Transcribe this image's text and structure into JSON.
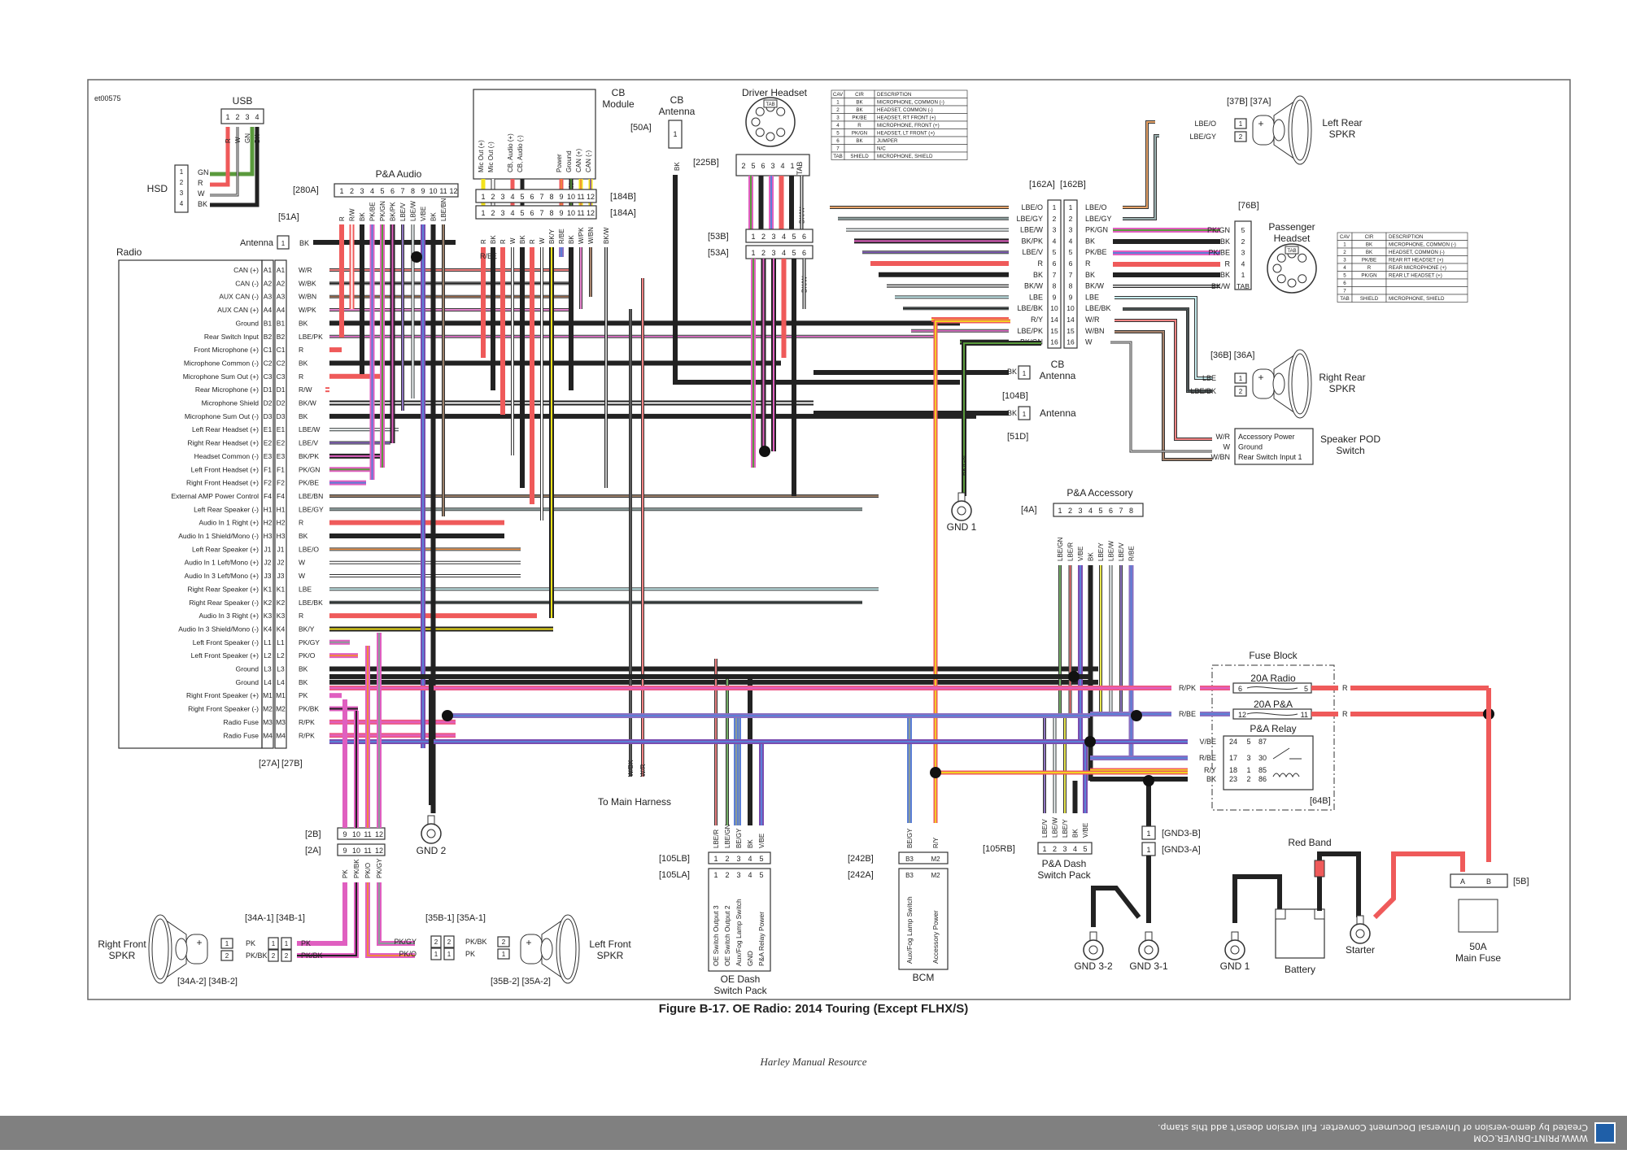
{
  "document": {
    "figure_id": "et00575",
    "caption": "Figure B-17. OE Radio: 2014 Touring (Except FLHX/S)",
    "footer": "Harley Manual Resource",
    "stamp": {
      "line1": "WWW.PRINT-DRIVER.COM",
      "line2": "Created by demo-version of Universal Document Converter. Full version doesn't add this stamp."
    }
  },
  "wire_colors": {
    "R": "#ef5a5a",
    "BK": "#222222",
    "W": "#ffffff",
    "GN": "#5a9a3c",
    "Y": "#f3e31b",
    "O": "#f08a3c",
    "PK": "#e05fc0",
    "V": "#7a4db0",
    "BE": "#5b7fd6",
    "LBE": "#c8eef0",
    "BN": "#8a5a3c",
    "GY": "#8a9a98",
    "R/PK": "#ec5a88",
    "R/BE": "#8a6fc0"
  },
  "components": {
    "usb": {
      "label": "USB",
      "pins": [
        "1",
        "2",
        "3",
        "4"
      ],
      "wires": [
        "R",
        "W",
        "GN",
        "BK"
      ]
    },
    "hsd": {
      "label": "HSD",
      "pins": [
        {
          "pin": "1",
          "wire": "GN"
        },
        {
          "pin": "2",
          "wire": "R"
        },
        {
          "pin": "3",
          "wire": "W"
        },
        {
          "pin": "4",
          "wire": "BK"
        }
      ]
    },
    "antenna_51a": {
      "label": "Antenna",
      "connector": "[51A]",
      "pin": "1",
      "wire": "BK"
    },
    "radio": {
      "label": "Radio",
      "connector_left": "[27A]",
      "connector_right": "[27B]",
      "pins": [
        {
          "pin": "A1",
          "desc": "CAN (+)",
          "wire": "W/R"
        },
        {
          "pin": "A2",
          "desc": "CAN (-)",
          "wire": "W/BK"
        },
        {
          "pin": "A3",
          "desc": "AUX CAN (-)",
          "wire": "W/BN"
        },
        {
          "pin": "A4",
          "desc": "AUX CAN (+)",
          "wire": "W/PK"
        },
        {
          "pin": "B1",
          "desc": "Ground",
          "wire": "BK"
        },
        {
          "pin": "B2",
          "desc": "Rear Switch Input",
          "wire": "LBE/PK"
        },
        {
          "pin": "C1",
          "desc": "Front Microphone (+)",
          "wire": "R"
        },
        {
          "pin": "C2",
          "desc": "Microphone Common (-)",
          "wire": "BK"
        },
        {
          "pin": "C3",
          "desc": "Microphone Sum Out (+)",
          "wire": "R"
        },
        {
          "pin": "D1",
          "desc": "Rear Microphone (+)",
          "wire": "R/W"
        },
        {
          "pin": "D2",
          "desc": "Microphone Shield",
          "wire": "BK/W"
        },
        {
          "pin": "D3",
          "desc": "Microphone Sum Out (-)",
          "wire": "BK"
        },
        {
          "pin": "E1",
          "desc": "Left Rear Headset (+)",
          "wire": "LBE/W"
        },
        {
          "pin": "E2",
          "desc": "Right Rear Headset (+)",
          "wire": "LBE/V"
        },
        {
          "pin": "E3",
          "desc": "Headset Common (-)",
          "wire": "BK/PK"
        },
        {
          "pin": "F1",
          "desc": "Left Front Headset (+)",
          "wire": "PK/GN"
        },
        {
          "pin": "F2",
          "desc": "Right Front Headset (+)",
          "wire": "PK/BE"
        },
        {
          "pin": "F4",
          "desc": "External AMP Power Control",
          "wire": "LBE/BN"
        },
        {
          "pin": "H1",
          "desc": "Left Rear Speaker (-)",
          "wire": "LBE/GY"
        },
        {
          "pin": "H2",
          "desc": "Audio In 1 Right (+)",
          "wire": "R"
        },
        {
          "pin": "H3",
          "desc": "Audio In 1 Shield/Mono (-)",
          "wire": "BK"
        },
        {
          "pin": "J1",
          "desc": "Left Rear Speaker (+)",
          "wire": "LBE/O"
        },
        {
          "pin": "J2",
          "desc": "Audio In 1 Left/Mono (+)",
          "wire": "W"
        },
        {
          "pin": "J3",
          "desc": "Audio In 3 Left/Mono (+)",
          "wire": "W"
        },
        {
          "pin": "K1",
          "desc": "Right Rear Speaker (+)",
          "wire": "LBE"
        },
        {
          "pin": "K2",
          "desc": "Right Rear Speaker (-)",
          "wire": "LBE/BK"
        },
        {
          "pin": "K3",
          "desc": "Audio In 3 Right (+)",
          "wire": "R"
        },
        {
          "pin": "K4",
          "desc": "Audio In 3 Shield/Mono (-)",
          "wire": "BK/Y"
        },
        {
          "pin": "L1",
          "desc": "Left Front Speaker (-)",
          "wire": "PK/GY"
        },
        {
          "pin": "L2",
          "desc": "Left Front Speaker (+)",
          "wire": "PK/O"
        },
        {
          "pin": "L3",
          "desc": "Ground",
          "wire": "BK"
        },
        {
          "pin": "L4",
          "desc": "Ground",
          "wire": "BK"
        },
        {
          "pin": "M1",
          "desc": "Right Front Speaker (+)",
          "wire": "PK"
        },
        {
          "pin": "M2",
          "desc": "Right Front Speaker (-)",
          "wire": "PK/BK"
        },
        {
          "pin": "M3",
          "desc": "Radio Fuse",
          "wire": "R/PK"
        },
        {
          "pin": "M4",
          "desc": "Radio Fuse",
          "wire": "R/PK"
        }
      ]
    },
    "pa_audio": {
      "label": "P&A Audio",
      "connector": "[280A]",
      "pins": [
        "1",
        "2",
        "3",
        "4",
        "5",
        "6",
        "7",
        "8",
        "9",
        "10",
        "11",
        "12"
      ],
      "wires": [
        "R",
        "R/W",
        "BK",
        "PK/BE",
        "PK/GN",
        "BK/PK",
        "LBE/V",
        "LBE/W",
        "V/BE",
        "BK",
        "LBE/BN",
        ""
      ]
    },
    "cb_module": {
      "label": "CB Module",
      "functions": [
        "Mic Out (+)",
        "Mic Out (-)",
        "",
        "CB, Audio (+)",
        "CB, Audio (-)",
        "",
        "",
        "",
        "Power",
        "Ground",
        "CAN (+)",
        "CAN (-)"
      ],
      "top_wires": [
        "Y",
        "W",
        "",
        "R",
        "BK",
        "",
        "",
        "",
        "R/O",
        "BK/GN",
        "Y/O",
        "Y/V"
      ],
      "connector_b": "[184B]",
      "connector_a": "[184A]",
      "pins": [
        "1",
        "2",
        "3",
        "4",
        "5",
        "6",
        "7",
        "8",
        "9",
        "10",
        "11",
        "12"
      ],
      "bottom_wires": [
        "R",
        "BK",
        "R",
        "W",
        "BK",
        "R",
        "W",
        "BK/Y",
        "R/BE",
        "BK",
        "W/PK",
        "W/BN"
      ],
      "extra_wire": "BK/W"
    },
    "cb_antenna_50a": {
      "label": "CB Antenna",
      "connector": "[50A]",
      "pin": "1",
      "wire": "BK"
    },
    "driver_headset": {
      "label": "Driver Headset",
      "connector": "[225B]",
      "pins": [
        "2",
        "5",
        "6",
        "3",
        "4",
        "1",
        "TAB"
      ],
      "wires": [
        "PK/GN",
        "BK",
        "PK/BE",
        "R",
        "BK",
        "BK/W"
      ],
      "connector_53b": "[53B]",
      "connector_53a": "[53A]",
      "pins_53": [
        "1",
        "2",
        "3",
        "4",
        "5",
        "6"
      ],
      "wires_53a": [
        "PK/GN",
        "BK/PK",
        "BK/PK",
        "R",
        "BK",
        "BK/W"
      ],
      "table": {
        "headers": [
          "CAV",
          "CIR",
          "DESCRIPTION"
        ],
        "rows": [
          [
            "1",
            "BK",
            "MICROPHONE, COMMON (-)"
          ],
          [
            "2",
            "BK",
            "HEADSET, COMMON (-)"
          ],
          [
            "3",
            "PK/BE",
            "HEADSET, RT FRONT (+)"
          ],
          [
            "4",
            "R",
            "MICROPHONE, FRONT (+)"
          ],
          [
            "5",
            "PK/GN",
            "HEADSET, LT FRONT (+)"
          ],
          [
            "6",
            "BK",
            "JUMPER"
          ],
          [
            "7",
            "",
            "N/C"
          ],
          [
            "TAB",
            "SHIELD",
            "MICROPHONE, SHIELD"
          ]
        ]
      }
    },
    "connector_162": {
      "label_a": "[162A]",
      "label_b": "[162B]",
      "pins": [
        "1",
        "2",
        "3",
        "4",
        "5",
        "6",
        "7",
        "8",
        "9",
        "10",
        "14",
        "15",
        "16"
      ],
      "left_wires": [
        "LBE/O",
        "LBE/GY",
        "LBE/W",
        "BK/PK",
        "LBE/V",
        "R",
        "BK",
        "BK/W",
        "LBE",
        "LBE/BK",
        "R/Y",
        "LBE/PK",
        "BK/GN"
      ],
      "right_wires": [
        "LBE/O",
        "LBE/GY",
        "PK/GN",
        "BK",
        "PK/BE",
        "R",
        "BK",
        "BK/W",
        "LBE",
        "LBE/BK",
        "W/R",
        "W/BN",
        "W"
      ]
    },
    "left_rear_spkr": {
      "label": "Left Rear SPKR",
      "connectors": "[37B] [37A]",
      "pins": [
        {
          "pin": "1",
          "wire": "LBE/O"
        },
        {
          "pin": "2",
          "wire": "LBE/GY"
        }
      ]
    },
    "passenger_headset": {
      "label": "Passenger Headset",
      "connector": "[76B]",
      "pins": [
        {
          "pin": "5",
          "wire": "PK/GN"
        },
        {
          "pin": "2",
          "wire": "BK"
        },
        {
          "pin": "3",
          "wire": "PK/BE"
        },
        {
          "pin": "4",
          "wire": "R"
        },
        {
          "pin": "1",
          "wire": "BK"
        },
        {
          "pin": "TAB",
          "wire": "BK/W"
        }
      ],
      "table": {
        "headers": [
          "CAV",
          "CIR",
          "DESCRIPTION"
        ],
        "rows": [
          [
            "1",
            "BK",
            "MICROPHONE, COMMON (-)"
          ],
          [
            "2",
            "BK",
            "HEADSET, COMMON (-)"
          ],
          [
            "3",
            "PK/BE",
            "REAR RT HEADSET (+)"
          ],
          [
            "4",
            "R",
            "REAR MICROPHONE (+)"
          ],
          [
            "5",
            "PK/GN",
            "REAR LT HEADSET (+)"
          ],
          [
            "6",
            "",
            ""
          ],
          [
            "7",
            "",
            ""
          ],
          [
            "TAB",
            "SHIELD",
            "MICROPHONE, SHIELD"
          ]
        ]
      }
    },
    "cb_antenna_104b": {
      "label": "CB Antenna",
      "connector": "[104B]",
      "pin": "1",
      "wire": "BK"
    },
    "antenna_51d": {
      "label": "Antenna",
      "connector": "[51D]",
      "pin": "1",
      "wire": "BK"
    },
    "right_rear_spkr": {
      "label": "Right Rear SPKR",
      "connectors": "[36B] [36A]",
      "pins": [
        {
          "pin": "1",
          "wire": "LBE"
        },
        {
          "pin": "2",
          "wire": "LBE/BK"
        }
      ]
    },
    "speaker_pod_switch": {
      "label": "Speaker POD Switch",
      "pins": [
        {
          "function": "Accessory Power",
          "wire": "W/R"
        },
        {
          "function": "Ground",
          "wire": "W"
        },
        {
          "function": "Rear Switch Input 1",
          "wire": "W/BN"
        }
      ]
    },
    "gnd1_upper": {
      "label": "GND 1",
      "wire": "BK/GN"
    },
    "pa_accessory": {
      "label": "P&A Accessory",
      "connector": "[4A]",
      "pins": [
        "1",
        "2",
        "3",
        "4",
        "5",
        "6",
        "7",
        "8"
      ],
      "wires": [
        "LBE/GN",
        "LBE/R",
        "V/BE",
        "BK",
        "LBE/Y",
        "LBE/W",
        "LBE/V",
        "R/BE"
      ]
    },
    "fuse_block": {
      "label": "Fuse Block",
      "connector": "[64B]",
      "fuses": [
        {
          "name": "20A Radio",
          "in_pin": "6",
          "out_pin": "5",
          "in_wire": "R/PK",
          "out_wire": "R"
        },
        {
          "name": "20A P&A",
          "in_pin": "12",
          "out_pin": "11",
          "in_wire": "R/BE",
          "out_wire": "R"
        }
      ],
      "relay": {
        "name": "P&A Relay",
        "rows": [
          {
            "block_pin": "24",
            "relay_pin": "5",
            "terminal": "87",
            "wire": "V/BE"
          },
          {
            "block_pin": "17",
            "relay_pin": "3",
            "terminal": "30",
            "wire": "R/BE"
          },
          {
            "block_pin": "18",
            "relay_pin": "1",
            "terminal": "85",
            "wire": "R/Y"
          },
          {
            "block_pin": "23",
            "relay_pin": "2",
            "terminal": "86",
            "wire": "BK"
          }
        ]
      }
    },
    "pa_dash_switch_pack": {
      "label": "P&A Dash Switch Pack",
      "connector": "[105RB]",
      "pins": [
        "1",
        "2",
        "3",
        "4",
        "5"
      ],
      "wires": [
        "LBE/V",
        "LBE/W",
        "LBE/Y",
        "BK",
        "V/BE"
      ]
    },
    "gnd3": {
      "connector_b": "[GND3-B]",
      "connector_a": "[GND3-A]",
      "pin": "1",
      "wire": "BK",
      "grounds": [
        "GND 3-2",
        "GND 3-1"
      ]
    },
    "battery_section": {
      "red_band": "Red Band",
      "gnd": "GND 1",
      "battery": "Battery",
      "starter": "Starter",
      "wires": [
        "BK",
        "BK",
        "BK",
        "R"
      ]
    },
    "main_fuse": {
      "label": "50A Main Fuse",
      "connector": "[5B]",
      "pins": [
        "A",
        "B"
      ],
      "wires": [
        "R",
        "R"
      ]
    },
    "oe_dash_switch_pack": {
      "label": "OE Dash Switch Pack",
      "connector_b": "[105LB]",
      "connector_a": "[105LA]",
      "pins": [
        "1",
        "2",
        "3",
        "4",
        "5"
      ],
      "wires": [
        "LBE/R",
        "LBE/GN",
        "BE/GY",
        "BK",
        "V/BE"
      ],
      "functions": [
        "OE Switch Output 3",
        "OE Switch Output 2",
        "Aux/Fog Lamp Switch",
        "GND",
        "P&A Relay Power"
      ]
    },
    "bcm": {
      "label": "BCM",
      "connector_b": "[242B]",
      "connector_a": "[242A]",
      "pins": [
        "B3",
        "M2"
      ],
      "wires": [
        "BE/GY",
        "R/Y"
      ],
      "functions": [
        "Aux/Fog Lamp Switch",
        "Accessory Power"
      ]
    },
    "main_harness": {
      "label": "To Main Harness",
      "wires": [
        "W/BK",
        "W/R"
      ]
    },
    "gnd2": {
      "label": "GND 2",
      "wire": "BK"
    },
    "connector_2": {
      "label_b": "[2B]",
      "label_a": "[2A]",
      "pins": [
        "9",
        "10",
        "11",
        "12"
      ],
      "wires": [
        "PK",
        "PK/BK",
        "PK/O",
        "PK/GY"
      ]
    },
    "right_front_spkr": {
      "label": "Right Front SPKR",
      "connectors_top": "[34A-1] [34B-1]",
      "connectors_bottom": "[34A-2] [34B-2]",
      "pins": [
        {
          "pin": "1",
          "wire": "PK"
        },
        {
          "pin": "2",
          "wire": "PK/BK"
        }
      ]
    },
    "left_front_spkr": {
      "label": "Left Front SPKR",
      "connectors_top": "[35B-1] [35A-1]",
      "connectors_bottom": "[35B-2] [35A-2]",
      "pins": [
        {
          "pin": "2",
          "wire": "PK/BK"
        },
        {
          "pin": "1",
          "wire": "PK"
        }
      ],
      "inbound": [
        {
          "pin": "2",
          "wire": "PK/GY"
        },
        {
          "pin": "1",
          "wire": "PK/O"
        }
      ]
    }
  }
}
